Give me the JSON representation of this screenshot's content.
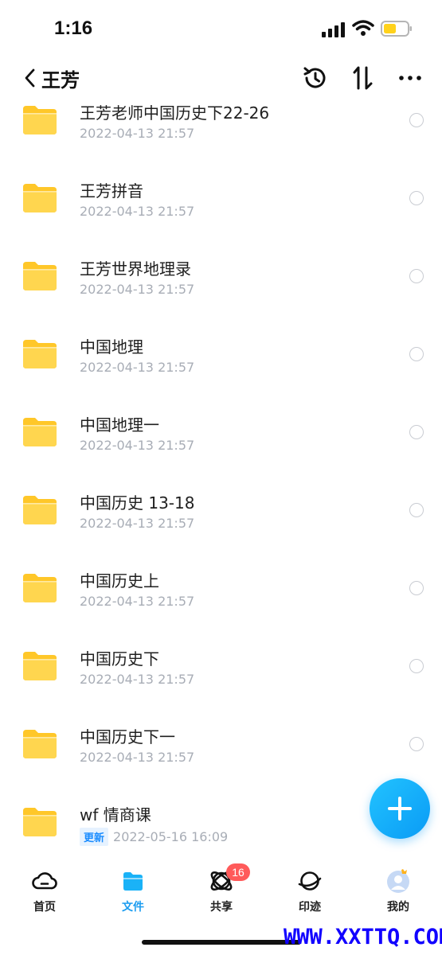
{
  "status_bar": {
    "time": "1:16"
  },
  "nav": {
    "title": "王芳",
    "back_icon": "chevron-left-icon",
    "actions": [
      "history-icon",
      "sort-icon",
      "more-icon"
    ]
  },
  "files": [
    {
      "name": "王芳老师中国历史下22-26",
      "date": "2022-04-13 21:57"
    },
    {
      "name": "王芳拼音",
      "date": "2022-04-13 21:57"
    },
    {
      "name": "王芳世界地理录",
      "date": "2022-04-13 21:57"
    },
    {
      "name": "中国地理",
      "date": "2022-04-13 21:57"
    },
    {
      "name": "中国地理一",
      "date": "2022-04-13 21:57"
    },
    {
      "name": "中国历史 13-18",
      "date": "2022-04-13 21:57"
    },
    {
      "name": "中国历史上",
      "date": "2022-04-13 21:57"
    },
    {
      "name": "中国历史下",
      "date": "2022-04-13 21:57"
    },
    {
      "name": "中国历史下一",
      "date": "2022-04-13 21:57"
    },
    {
      "name": "wf 情商课",
      "date": "2022-05-16 16:09",
      "badge": "更新"
    }
  ],
  "tabs": [
    {
      "label": "首页",
      "icon": "cloud-icon"
    },
    {
      "label": "文件",
      "icon": "folder-icon",
      "active": true
    },
    {
      "label": "共享",
      "icon": "orbit-icon",
      "badge": "16"
    },
    {
      "label": "印迹",
      "icon": "planet-icon"
    },
    {
      "label": "我的",
      "icon": "avatar-icon"
    }
  ],
  "colors": {
    "accent": "#1a9cf0",
    "folder": "#ffc729",
    "badge": "#ff5a5a"
  },
  "watermark": "WWW.XXTTQ.COM"
}
